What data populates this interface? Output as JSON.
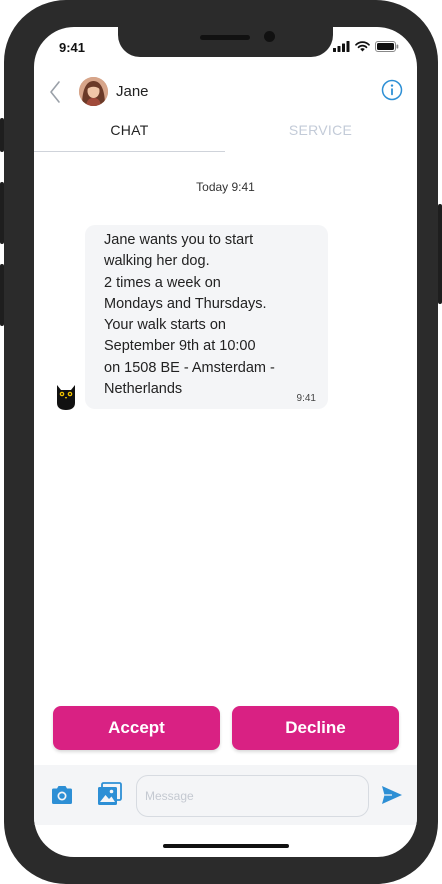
{
  "status_bar": {
    "time": "9:41"
  },
  "header": {
    "contact_name": "Jane"
  },
  "tabs": [
    {
      "label": "CHAT",
      "active": true
    },
    {
      "label": "SERVICE",
      "active": false
    }
  ],
  "conversation": {
    "date_label": "Today 9:41",
    "messages": [
      {
        "lines": [
          "Jane wants you to start",
          "walking her dog.",
          "2 times a week on",
          "Mondays and Thursdays.",
          "Your walk starts on",
          "September 9th at 10:00",
          "on 1508 BE - Amsterdam -",
          "Netherlands"
        ],
        "time": "9:41"
      }
    ]
  },
  "actions": {
    "accept_label": "Accept",
    "decline_label": "Decline"
  },
  "composer": {
    "placeholder": "Message"
  },
  "icons": {
    "back": "chevron-left-icon",
    "info": "info-icon",
    "camera": "camera-icon",
    "gallery": "image-icon",
    "send": "send-icon",
    "bot": "owl-icon"
  },
  "colors": {
    "primary": "#d92183",
    "accent_blue": "#2d8fd5",
    "tab_inactive": "#c3cbd8",
    "bubble_bg": "#f4f5f7"
  }
}
